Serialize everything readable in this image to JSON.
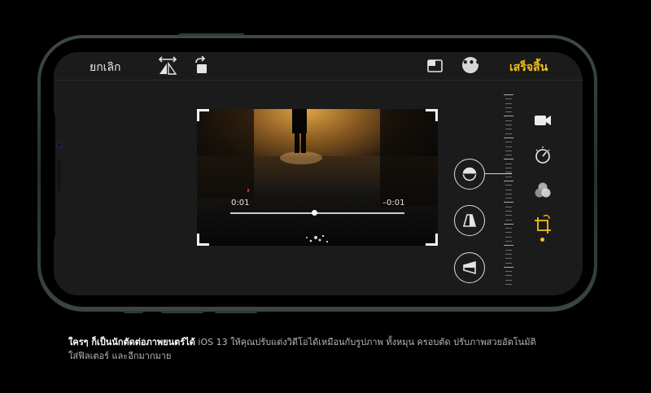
{
  "editor": {
    "cancel_label": "ยกเลิก",
    "done_label": "เสร็จสิ้น",
    "more_label": "•••",
    "accent_color": "#f4c21d"
  },
  "video": {
    "time_elapsed": "0:01",
    "time_remaining": "–0:01",
    "playback_fraction": 0.48
  },
  "icons": {
    "toolbar": [
      "flip-icon",
      "rotate-icon",
      "aspect-ratio-icon",
      "more-icon"
    ],
    "crop_tools": [
      "straighten-icon",
      "vertical-perspective-icon",
      "horizontal-perspective-icon"
    ],
    "modes": [
      "video-camera-icon",
      "adjust-dial-icon",
      "filters-icon",
      "crop-icon"
    ]
  },
  "caption": {
    "headline": "ใครๆ ก็เป็นนักตัดต่อภาพยนตร์ได้",
    "line1": " iOS 13 ให้คุณปรับแต่งวิดีโอได้เหมือนกับรูปภาพ ทั้งหมุน ครอบตัด ปรับภาพสวยอัตโนมัติ",
    "line2": "ใส่ฟิลเตอร์ และอีกมากมาย"
  }
}
